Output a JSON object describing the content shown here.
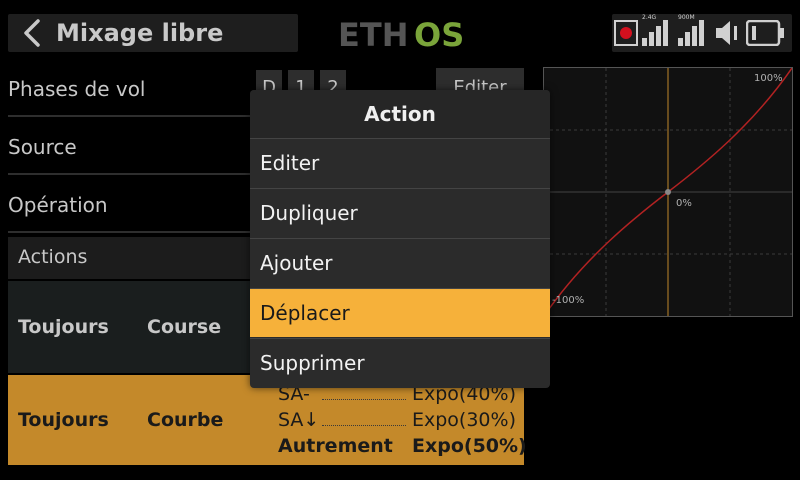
{
  "header": {
    "title": "Mixage libre",
    "logo_left": "ETH",
    "logo_right": "OS",
    "signal1_label": "2.4G",
    "signal2_label": "900M"
  },
  "colors": {
    "accent": "#f6b13a",
    "logo_grey": "#555555",
    "logo_green": "#7aa43a",
    "record_red": "#d2101e",
    "curve": "#b22222",
    "vertical_axis": "#c0872a"
  },
  "settings": {
    "flight_modes_label": "Phases de vol",
    "flight_modes_chips": [
      "D",
      "1",
      "2"
    ],
    "edit_label": "Editer",
    "source_label": "Source",
    "operation_label": "Opération"
  },
  "actions": {
    "title": "Actions",
    "row1": {
      "condition": "Toujours",
      "type": "Course"
    },
    "row2": {
      "condition": "Toujours",
      "type": "Courbe",
      "lines": [
        {
          "source": "SA-",
          "value": "Expo(40%)"
        },
        {
          "source": "SA↓",
          "value": "Expo(30%)"
        },
        {
          "source": "Autrement",
          "value": "Expo(50%)"
        }
      ]
    }
  },
  "graph": {
    "max_label": "100%",
    "mid_label": "0%",
    "min_label": "-100%"
  },
  "modal": {
    "title": "Action",
    "items": [
      "Editer",
      "Dupliquer",
      "Ajouter",
      "Déplacer",
      "Supprimer"
    ],
    "selected_index": 3
  },
  "icons": [
    "back-arrow-icon",
    "record-icon",
    "signal-bars-icon",
    "speaker-icon",
    "battery-icon"
  ]
}
